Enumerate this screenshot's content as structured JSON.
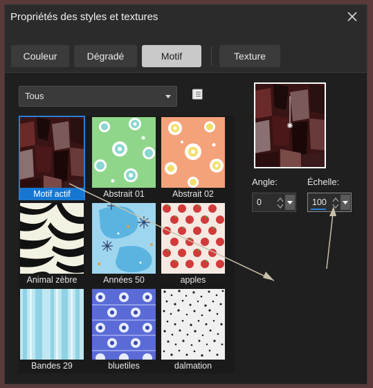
{
  "window": {
    "title": "Propriétés des styles et textures"
  },
  "tabs": [
    {
      "label": "Couleur",
      "active": false
    },
    {
      "label": "Dégradé",
      "active": false
    },
    {
      "label": "Motif",
      "active": true
    },
    {
      "label": "Texture",
      "active": false
    }
  ],
  "filter": {
    "selected": "Tous"
  },
  "patterns": [
    {
      "label": "Motif actif",
      "selected": true
    },
    {
      "label": "Abstrait 01"
    },
    {
      "label": "Abstrait 02"
    },
    {
      "label": "Animal zèbre"
    },
    {
      "label": "Années 50"
    },
    {
      "label": "apples"
    },
    {
      "label": "Bandes 29"
    },
    {
      "label": "bluetiles"
    },
    {
      "label": "dalmation"
    }
  ],
  "angle": {
    "label": "Angle:",
    "value": "0"
  },
  "scale": {
    "label": "Échelle:",
    "value": "100"
  },
  "colors": {
    "accent": "#1677d2",
    "background": "#1f1f1f",
    "annotation": "#c8c0a8"
  }
}
